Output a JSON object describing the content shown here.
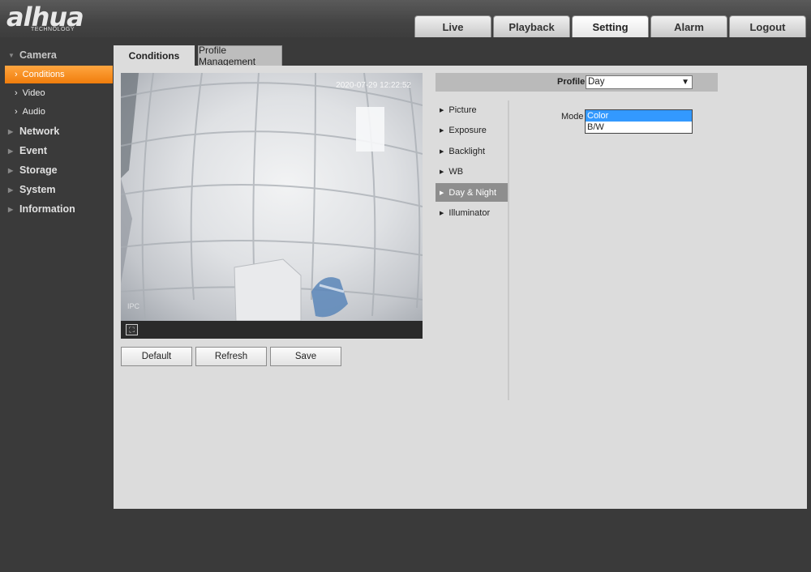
{
  "brand": {
    "name": "alhua",
    "tagline": "TECHNOLOGY"
  },
  "topnav": [
    "Live",
    "Playback",
    "Setting",
    "Alarm",
    "Logout"
  ],
  "sidebar": {
    "groups": [
      {
        "label": "Camera",
        "open": true
      },
      {
        "label": "Network"
      },
      {
        "label": "Event"
      },
      {
        "label": "Storage"
      },
      {
        "label": "System"
      },
      {
        "label": "Information"
      }
    ],
    "camera_items": [
      "Conditions",
      "Video",
      "Audio"
    ]
  },
  "tabs": {
    "conditions": "Conditions",
    "profile_management": "Profile Management"
  },
  "video": {
    "timestamp": "2020-07-29 12:22:52",
    "cam_label": "IPC"
  },
  "buttons": {
    "default": "Default",
    "refresh": "Refresh",
    "save": "Save"
  },
  "profile": {
    "label": "Profile",
    "value": "Day"
  },
  "submenu": [
    "Picture",
    "Exposure",
    "Backlight",
    "WB",
    "Day & Night",
    "Illuminator"
  ],
  "mode": {
    "label": "Mode",
    "options": [
      "Color",
      "B/W"
    ],
    "selected": "Color"
  },
  "colors": {
    "accent": "#f58a1f",
    "selection": "#3399ff",
    "active_submenu": "#8e8e8e"
  }
}
